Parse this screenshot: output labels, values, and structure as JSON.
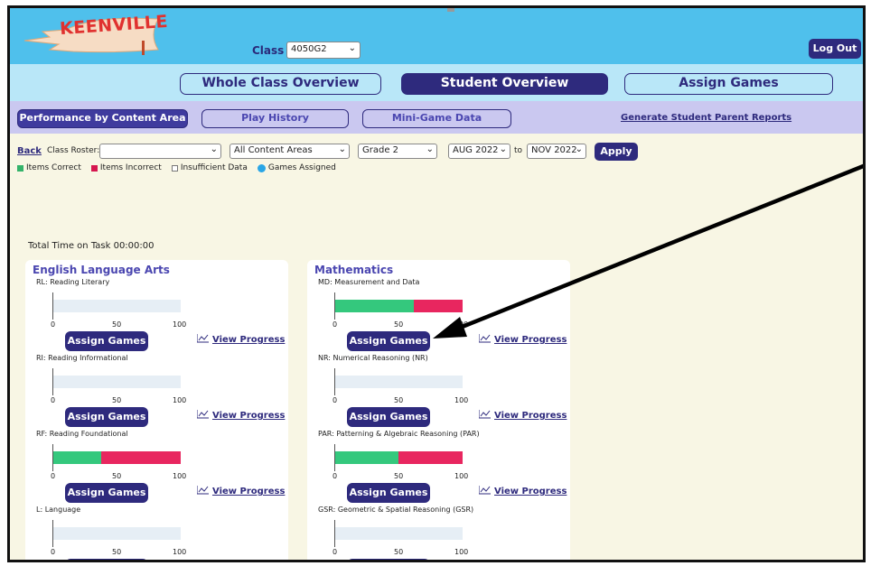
{
  "header": {
    "logo_text": "KEENVILLE",
    "class_label": "Class",
    "class_value": "4050G2",
    "logout_label": "Log Out"
  },
  "nav": {
    "tabs": [
      {
        "label": "Whole Class Overview",
        "active": false
      },
      {
        "label": "Student Overview",
        "active": true
      },
      {
        "label": "Assign Games",
        "active": false
      }
    ]
  },
  "subnav": {
    "tabs": [
      {
        "label": "Performance by Content Area",
        "active": true
      },
      {
        "label": "Play History",
        "active": false
      },
      {
        "label": "Mini-Game Data",
        "active": false
      }
    ],
    "report_link": "Generate Student Parent Reports"
  },
  "filters": {
    "back_label": "Back",
    "roster_label": "Class Roster:",
    "roster_value": "",
    "content_area_value": "All Content Areas",
    "grade_value": "Grade 2",
    "from_value": "AUG 2022",
    "to_label": "to",
    "to_value": "NOV 2022",
    "apply_label": "Apply"
  },
  "legend": {
    "correct": "Items Correct",
    "incorrect": "Items Incorrect",
    "insufficient": "Insufficient Data",
    "assigned": "Games Assigned"
  },
  "total_time": "Total Time on Task 00:00:00",
  "axis_ticks": [
    "0",
    "50",
    "100"
  ],
  "assign_label": "Assign Games",
  "view_progress_label": "View Progress",
  "colors": {
    "brand": "#2e2a7d",
    "correct": "#34c87d",
    "incorrect": "#e8265f",
    "header": "#4fc0ec"
  },
  "cards": [
    {
      "title": "English Language Arts",
      "sections": [
        {
          "label": "RL: Reading Literary",
          "correct_pct": 0,
          "incorrect_pct": 0
        },
        {
          "label": "RI: Reading Informational",
          "correct_pct": 0,
          "incorrect_pct": 0
        },
        {
          "label": "RF: Reading Foundational",
          "correct_pct": 38,
          "incorrect_pct": 62
        },
        {
          "label": "L: Language",
          "correct_pct": 0,
          "incorrect_pct": 0
        }
      ]
    },
    {
      "title": "Mathematics",
      "sections": [
        {
          "label": "MD: Measurement and Data",
          "correct_pct": 62,
          "incorrect_pct": 38
        },
        {
          "label": "NR: Numerical Reasoning (NR)",
          "correct_pct": 0,
          "incorrect_pct": 0
        },
        {
          "label": "PAR: Patterning & Algebraic Reasoning (PAR)",
          "correct_pct": 50,
          "incorrect_pct": 50
        },
        {
          "label": "GSR: Geometric & Spatial Reasoning (GSR)",
          "correct_pct": 0,
          "incorrect_pct": 0
        }
      ]
    }
  ]
}
